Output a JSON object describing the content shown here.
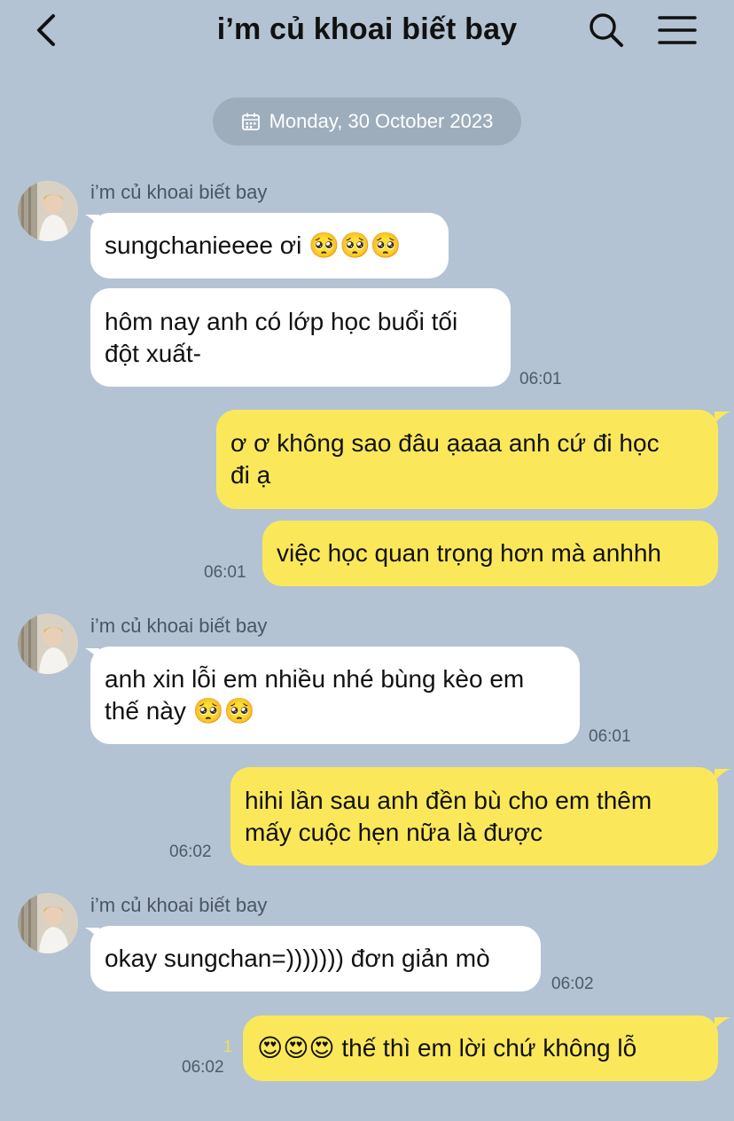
{
  "header": {
    "title": "i’m củ khoai biết bay"
  },
  "date_divider": "Monday, 30 October 2023",
  "messages": [
    {
      "sender": "i’m củ khoai biết bay",
      "text": "sungchanieeee ơi 🥺🥺🥺"
    },
    {
      "text": "hôm nay anh có lớp học buổi tối\nđột xuất-",
      "time": "06:01"
    },
    {
      "text": "ơ ơ không sao đâu ạaaa anh cứ đi học\nđi ạ"
    },
    {
      "text": "việc học quan trọng hơn mà anhhh",
      "time": "06:01"
    },
    {
      "sender": "i’m củ khoai biết bay",
      "text": "anh xin lỗi em nhiều nhé bùng kèo em\nthế này 🥺🥺",
      "time": "06:01"
    },
    {
      "text": "hihi lần sau anh đền bù cho em thêm\nmấy cuộc hẹn nữa là được",
      "time": "06:02"
    },
    {
      "sender": "i’m củ khoai biết bay",
      "text": "okay sungchan=))))))) đơn giản mò",
      "time": "06:02"
    },
    {
      "text": "😍😍😍 thế thì em lời chứ không lỗ",
      "time": "06:02",
      "unread_count": "1"
    }
  ],
  "colors": {
    "background": "#b3c3d3",
    "incoming_bubble": "#ffffff",
    "outgoing_bubble": "#fbe85a",
    "date_pill": "#9dadbc"
  },
  "icons": [
    "back-arrow-icon",
    "search-icon",
    "menu-icon",
    "calendar-icon",
    "avatar"
  ]
}
